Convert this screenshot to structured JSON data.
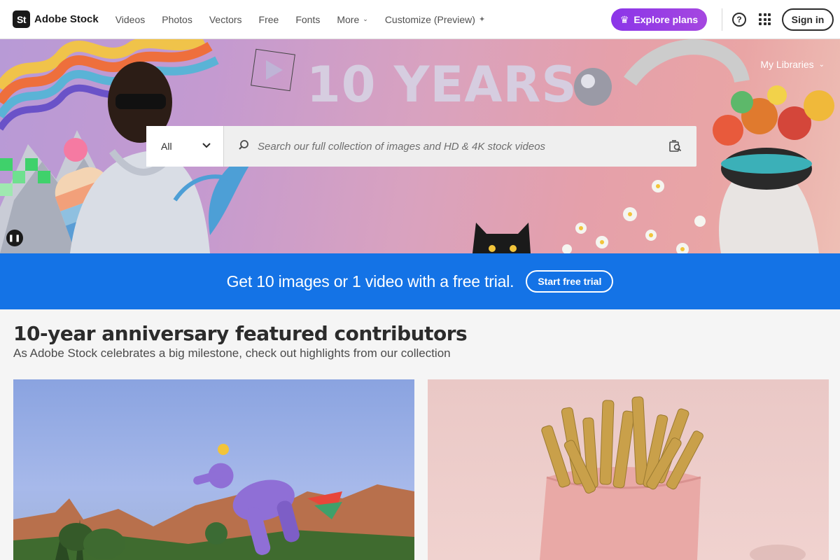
{
  "header": {
    "logo_mark": "St",
    "logo_text": "Adobe Stock",
    "nav": [
      {
        "label": "Videos"
      },
      {
        "label": "Photos"
      },
      {
        "label": "Vectors"
      },
      {
        "label": "Free"
      },
      {
        "label": "Fonts"
      },
      {
        "label": "More"
      },
      {
        "label": "Customize (Preview)"
      }
    ],
    "explore_label": "Explore plans",
    "signin_label": "Sign in"
  },
  "hero": {
    "title": "10 YEARS",
    "my_libraries": "My Libraries",
    "search": {
      "category": "All",
      "placeholder": "Search our full collection of images and HD & 4K stock videos"
    }
  },
  "banner": {
    "text": "Get 10 images or 1 video with a free trial.",
    "button_label": "Start free trial",
    "color": "#1473e6"
  },
  "featured": {
    "title": "10-year anniversary featured contributors",
    "subtitle": "As Adobe Stock celebrates a big milestone, check out highlights from our collection"
  },
  "colors": {
    "accent_purple": "#9b3fe4",
    "banner_blue": "#1473e6"
  }
}
